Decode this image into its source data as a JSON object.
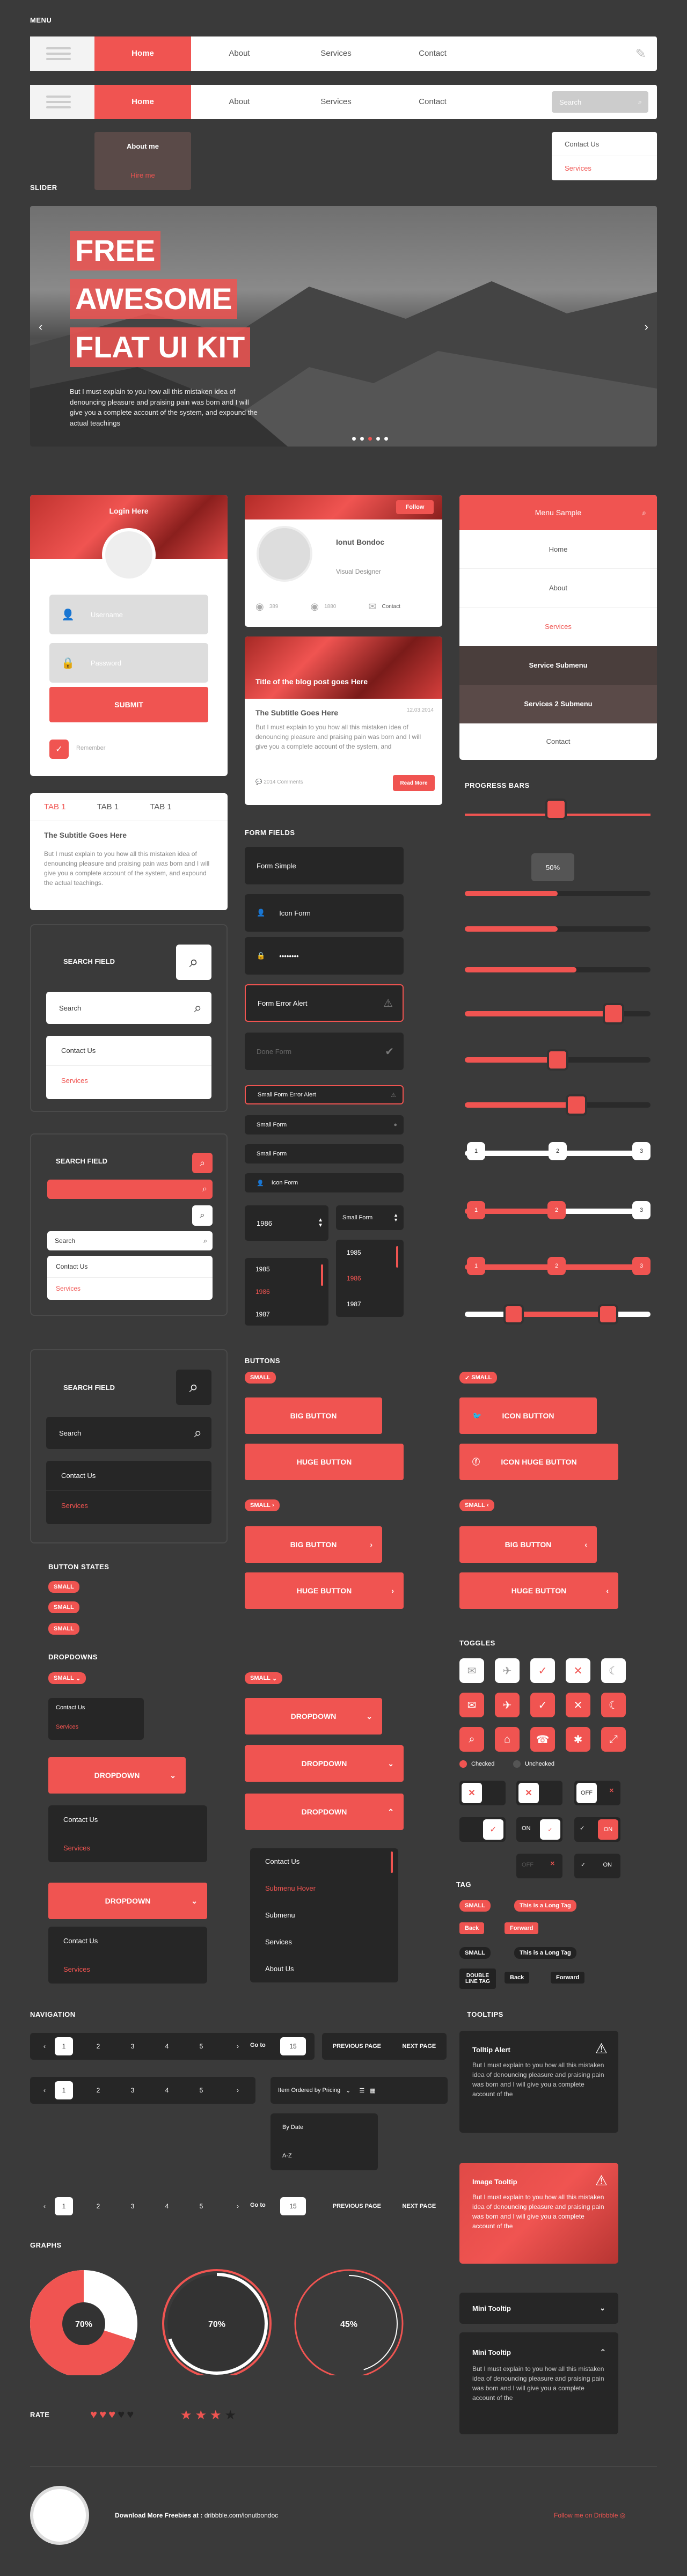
{
  "sections": {
    "menu": "MENU",
    "slider": "SLIDER",
    "progress": "PROGRESS BARS",
    "form_fields": "FORM FIELDS",
    "buttons": "BUTTONS",
    "button_states": "BUTTON STATES",
    "dropdowns": "DROPDOWNS",
    "toggles": "TOGGLES",
    "tag": "TAG",
    "navigation": "NAVIGATION",
    "tooltips": "TOOLTIPS",
    "graphs": "GRAPHS",
    "rate": "RATE"
  },
  "menu": {
    "items": [
      "Home",
      "About",
      "Services",
      "Contact"
    ],
    "search_placeholder": "Search",
    "submenu": [
      "About me",
      "Hire me"
    ],
    "right_submenu": [
      "Contact Us",
      "Services"
    ]
  },
  "slider": {
    "line1": "FREE",
    "line2": "AWESOME",
    "line3": "FLAT UI KIT",
    "body": "But I must explain to you how all this mistaken idea of denouncing pleasure and praising pain was born and I will give you a complete account of the system, and expound the actual teachings"
  },
  "login": {
    "title": "Login Here",
    "username": "Username",
    "password": "Password",
    "submit": "SUBMIT",
    "remember": "Remember"
  },
  "tabs": {
    "items": [
      "TAB 1",
      "TAB 1",
      "TAB 1"
    ],
    "title": "The Subtitle Goes Here",
    "body": "But I must explain to you how all this mistaken idea of denouncing pleasure and praising pain was born and I will give you a complete account of the system, and expound the actual teachings."
  },
  "profile": {
    "follow": "Follow",
    "name": "Ionut Bondoc",
    "role": "Visual Designer",
    "s1": "389",
    "s2": "1880",
    "contact": "Contact"
  },
  "blog": {
    "title": "Title of the blog post goes Here",
    "date": "12.03.2014",
    "subtitle": "The Subtitle Goes Here",
    "body": "But I must explain to you how all this mistaken idea of denouncing pleasure and praising pain was born and I will give you a complete account of the system, and",
    "comments": "2014 Comments",
    "read": "Read More"
  },
  "menu_sample": {
    "title": "Menu Sample",
    "items": [
      "Home",
      "About",
      "Services",
      "Service Submenu",
      "Services 2 Submenu",
      "Contact"
    ]
  },
  "search": {
    "label": "SEARCH FIELD",
    "placeholder": "Search",
    "opts": [
      "Contact Us",
      "Services"
    ]
  },
  "form": {
    "simple": "Form Simple",
    "icon": "Icon Form",
    "pass": "••••••••",
    "error": "Form Error Alert",
    "done": "Done Form",
    "s_error": "Small Form Error Alert",
    "s1": "Small Form",
    "s2": "Small Form",
    "s_icon": "Icon Form",
    "year": "1986",
    "years": [
      "1985",
      "1986",
      "1987"
    ],
    "small_select": "Small Form",
    "years2": [
      "1985",
      "1986",
      "1987"
    ]
  },
  "progress": {
    "pct": "50%",
    "values": [
      0.5,
      0.5,
      0.6,
      0.8,
      0.5,
      0.6,
      0.8
    ]
  },
  "buttons": {
    "small": "SMALL",
    "big": "BIG BUTTON",
    "huge": "HUGE BUTTON",
    "icon": "ICON BUTTON",
    "icon_huge": "ICON HUGE BUTTON"
  },
  "states": [
    "SMALL",
    "SMALL",
    "SMALL"
  ],
  "dropdowns": {
    "small": "SMALL",
    "label": "DROPDOWN",
    "opts": [
      "Contact Us",
      "Services"
    ],
    "list": [
      "Contact Us",
      "Submenu Hover",
      "Submenu",
      "Services",
      "About Us"
    ]
  },
  "toggles": {
    "checked": "Checked",
    "unchecked": "Unchecked",
    "off": "OFF",
    "on": "ON"
  },
  "tags": {
    "small": "SMALL",
    "long": "This is a Long Tag",
    "back": "Back",
    "forward": "Forward",
    "double": "DOUBLE LINE TAG"
  },
  "nav": {
    "pages": [
      "1",
      "2",
      "3",
      "4",
      "5"
    ],
    "goto": "Go to",
    "goval": "15",
    "prev": "PREVIOUS PAGE",
    "next": "NEXT PAGE",
    "order": "Item Ordered by Pricing",
    "order_opts": [
      "By Date",
      "A-Z"
    ]
  },
  "tooltips": {
    "alert": "Tolltip Alert",
    "image": "Image Tooltip",
    "body": "But I must explain to you how all this mistaken idea of denouncing pleasure and praising pain was born and I will give you a complete account of the",
    "mini": "Mini Tooltip"
  },
  "graphs": {
    "values": [
      "70%",
      "70%",
      "45%"
    ],
    "fractions": [
      0.7,
      0.7,
      0.45
    ]
  },
  "rate": {
    "hearts": 3,
    "hearts_total": 5,
    "stars": 3,
    "stars_total": 4
  },
  "footer": {
    "download": "Download More Freebies at : ",
    "link": "dribbble.com/ionutbondoc",
    "follow": "Follow me on Dribbble"
  },
  "colors": {
    "accent": "#f05451",
    "dark": "#2d2d2d",
    "bg": "#3a3a3a"
  }
}
